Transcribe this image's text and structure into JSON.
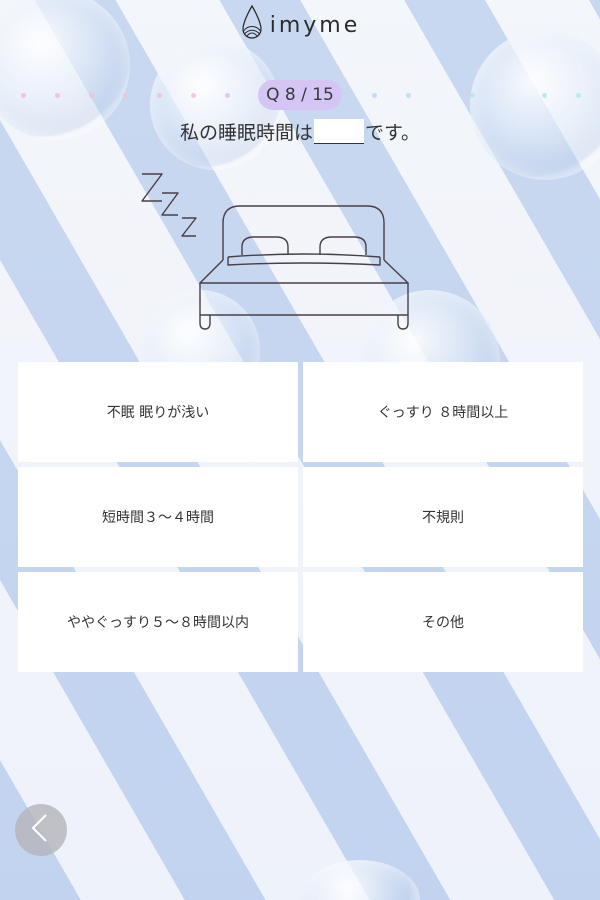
{
  "brand": {
    "name": "imyme",
    "logo_icon": "drop-logo-icon"
  },
  "progress": {
    "label": "Q 8 / 15",
    "current": 8,
    "total": 15,
    "badge_color": "#d5c5f5",
    "dot_colors": [
      "#f4c3d8",
      "#f4c3d8",
      "#f4c3d8",
      "#f4c3d8",
      "#f4c3d8",
      "#f0c8e8",
      "#e2c8f2",
      "#d8c9f5",
      "#d4ccf6",
      "#cfd2f6",
      "#c9d8f5",
      "#c4def3",
      "#bfe5ef",
      "#bbeaec",
      "#b8eee9"
    ]
  },
  "question": {
    "before": "私の睡眠時間は",
    "after": "です。"
  },
  "illustration": {
    "icon": "sleeping-bed-icon",
    "zzz": "Z Z Z"
  },
  "options": [
    {
      "label": "不眠 眠りが浅い"
    },
    {
      "label": "ぐっすり ８時間以上"
    },
    {
      "label": "短時間３〜４時間"
    },
    {
      "label": "不規則"
    },
    {
      "label": "ややぐっすり５〜８時間以内"
    },
    {
      "label": "その他"
    }
  ],
  "nav": {
    "back_icon": "chevron-left-icon"
  }
}
